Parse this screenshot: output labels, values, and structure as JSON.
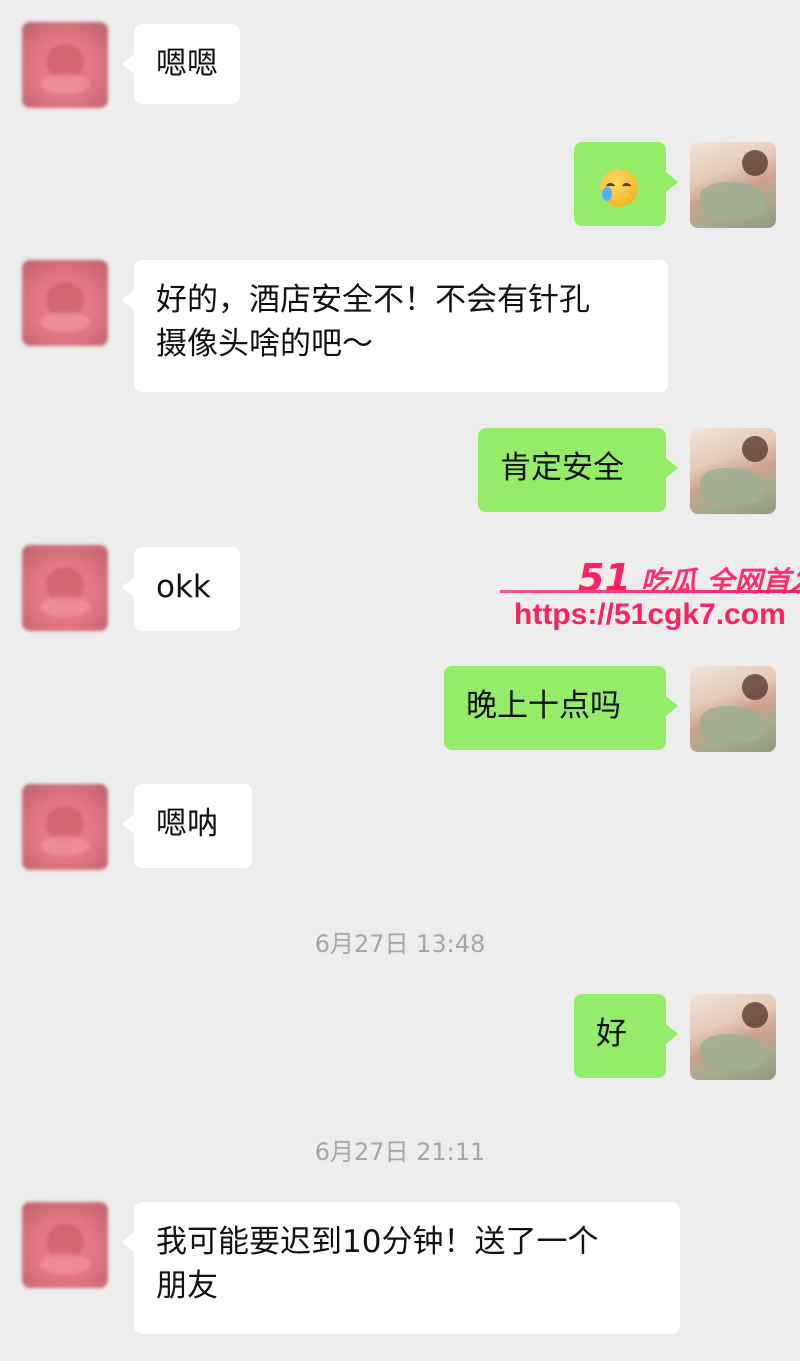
{
  "messages": [
    {
      "side": "in",
      "text": "嗯嗯"
    },
    {
      "side": "out",
      "type": "emoji",
      "emoji_name": "crying-laughing-emoji"
    },
    {
      "side": "in",
      "lines": [
        "好的，酒店安全不！不会有针孔",
        "摄像头啥的吧～"
      ]
    },
    {
      "side": "out",
      "text": "肯定安全"
    },
    {
      "side": "in",
      "text": "okk"
    },
    {
      "side": "out",
      "text": "晚上十点吗"
    },
    {
      "side": "in",
      "text": "嗯呐"
    },
    {
      "side": "out",
      "text": "好"
    },
    {
      "side": "in",
      "lines": [
        "我可能要迟到10分钟！送了一个",
        "朋友"
      ]
    }
  ],
  "timestamps": [
    "6月27日 13:48",
    "6月27日 21:11"
  ],
  "watermark": {
    "brand_number": "51",
    "brand_text": "吃瓜 全网首发",
    "url": "https://51cgk7.com"
  },
  "colors": {
    "background": "#ededed",
    "incoming_bubble": "#ffffff",
    "outgoing_bubble": "#95ec69",
    "timestamp_text": "#a6a6a6",
    "watermark": "#ff1f62"
  }
}
